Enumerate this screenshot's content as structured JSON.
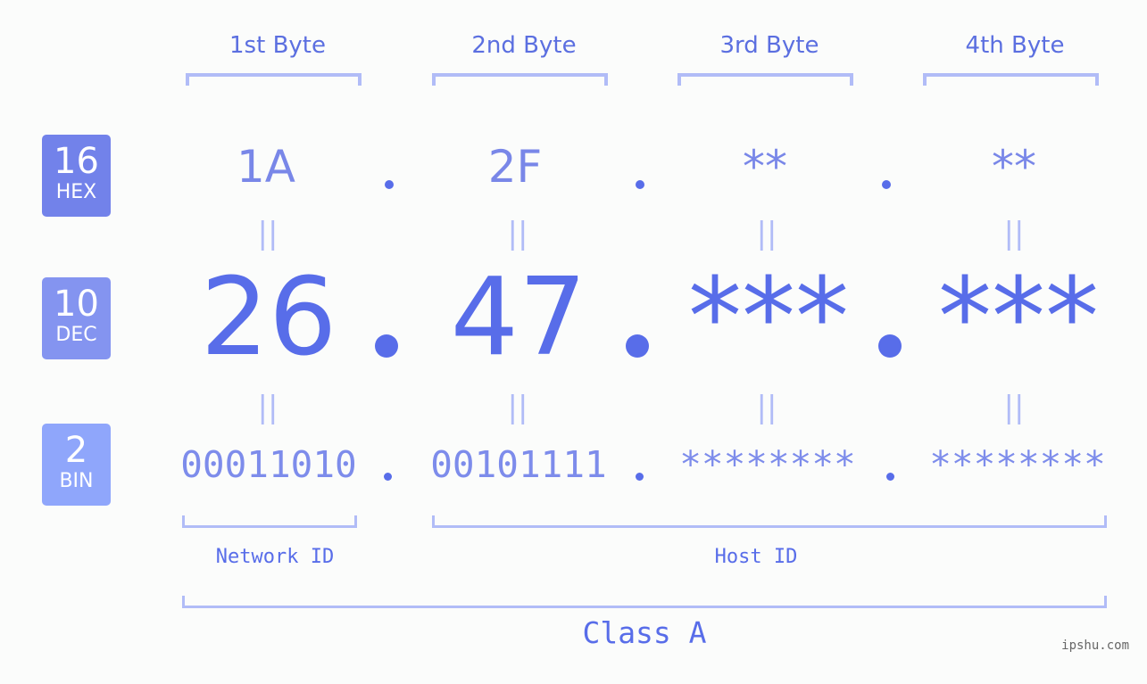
{
  "rows": {
    "hex": {
      "base": "16",
      "label": "HEX",
      "color": "#7282ea"
    },
    "dec": {
      "base": "10",
      "label": "DEC",
      "color": "#8494f0"
    },
    "bin": {
      "base": "2",
      "label": "BIN",
      "color": "#8fa6fb"
    }
  },
  "bytes": [
    {
      "header": "1st Byte",
      "hex": "1A",
      "dec": "26",
      "bin": "00011010"
    },
    {
      "header": "2nd Byte",
      "hex": "2F",
      "dec": "47",
      "bin": "00101111"
    },
    {
      "header": "3rd Byte",
      "hex": "**",
      "dec": "***",
      "bin": "********"
    },
    {
      "header": "4th Byte",
      "hex": "**",
      "dec": "***",
      "bin": "********"
    }
  ],
  "equals_glyph": "||",
  "network_id_label": "Network ID",
  "host_id_label": "Host ID",
  "class_label": "Class A",
  "watermark": "ipshu.com",
  "colors": {
    "accent": "#586de9",
    "bracket": "#b1bcf7",
    "hex_text": "#7987e8",
    "bin_text": "#7d8ceb"
  }
}
